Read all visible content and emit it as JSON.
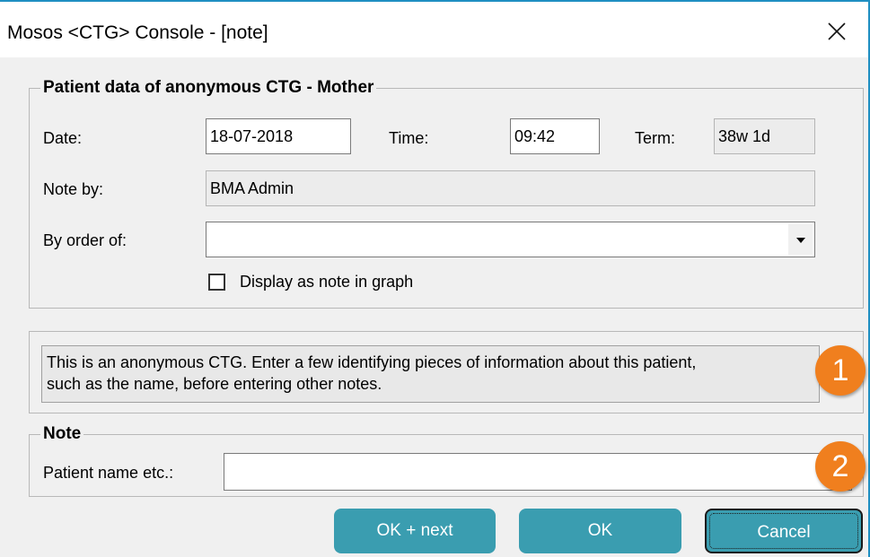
{
  "window": {
    "title": "Mosos <CTG> Console - [note]",
    "close_glyph": "✕"
  },
  "patient_group": {
    "legend": "Patient data of anonymous CTG - Mother",
    "date_label": "Date:",
    "date_value": "18-07-2018",
    "time_label": "Time:",
    "time_value": "09:42",
    "term_label": "Term:",
    "term_value": "38w 1d",
    "note_by_label": "Note by:",
    "note_by_value": "BMA Admin",
    "by_order_label": "By order of:",
    "by_order_value": "",
    "display_checkbox_label": "Display as note in graph",
    "display_checkbox_checked": false
  },
  "info": {
    "line1": "This is an anonymous CTG. Enter a few identifying pieces of information about this patient,",
    "line2": "such as the name, before entering other notes.",
    "badge": "1"
  },
  "note_group": {
    "legend": "Note",
    "patient_name_label": "Patient name etc.:",
    "patient_name_value": "",
    "badge": "2"
  },
  "buttons": {
    "ok_next": "OK + next",
    "ok": "OK",
    "cancel": "Cancel"
  },
  "colors": {
    "window_border": "#1f8fc2",
    "button_bg": "#3a9db0",
    "badge_bg": "#f07f1e"
  }
}
